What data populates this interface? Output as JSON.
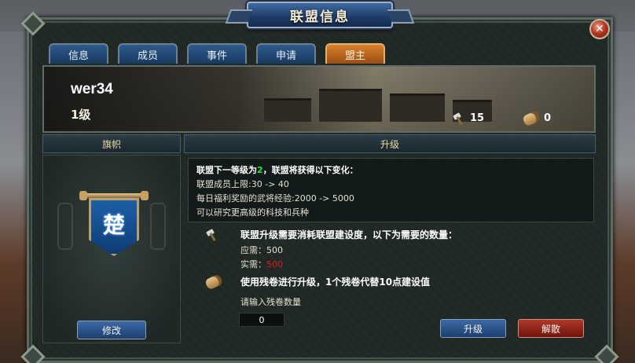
{
  "window": {
    "title": "联盟信息",
    "close_label": "✕"
  },
  "tabs": [
    {
      "label": "信息",
      "active": false
    },
    {
      "label": "成员",
      "active": false
    },
    {
      "label": "事件",
      "active": false
    },
    {
      "label": "申请",
      "active": false
    },
    {
      "label": "盟主",
      "active": true
    }
  ],
  "header": {
    "union_name": "wer34",
    "union_level": "1级",
    "resource_hammer": {
      "icon": "hammer-icon",
      "value": "15"
    },
    "resource_scroll": {
      "icon": "scroll-icon",
      "value": "0"
    }
  },
  "banner_section": {
    "heading": "旗帜",
    "flag_char": "楚",
    "modify_button": "修改"
  },
  "upgrade_section": {
    "heading": "升级",
    "info_head_prefix": "联盟下一等级为",
    "info_head_level": "2",
    "info_head_suffix": "，联盟将获得以下变化：",
    "info_lines": [
      "联盟成员上限:30 -> 40",
      "每日福利奖励的武将经验:2000 -> 5000",
      "可以研究更高级的科技和兵种"
    ],
    "cost_title": "联盟升级需要消耗联盟建设度，以下为需要的数量：",
    "cost_need_label": "应需：",
    "cost_need_value": "500",
    "cost_have_label": "实需：",
    "cost_have_value": "500",
    "scroll_title": "使用残卷进行升级，1个残卷代替10点建设值",
    "scroll_prompt": "请输入残卷数量",
    "scroll_input_value": "0",
    "upgrade_button": "升级",
    "disband_button": "解散"
  },
  "colors": {
    "accent_orange": "#d8822e",
    "button_blue": "#2c568e",
    "button_red": "#9a2618",
    "level_green": "#34e034",
    "cost_red": "#d81e1e"
  }
}
